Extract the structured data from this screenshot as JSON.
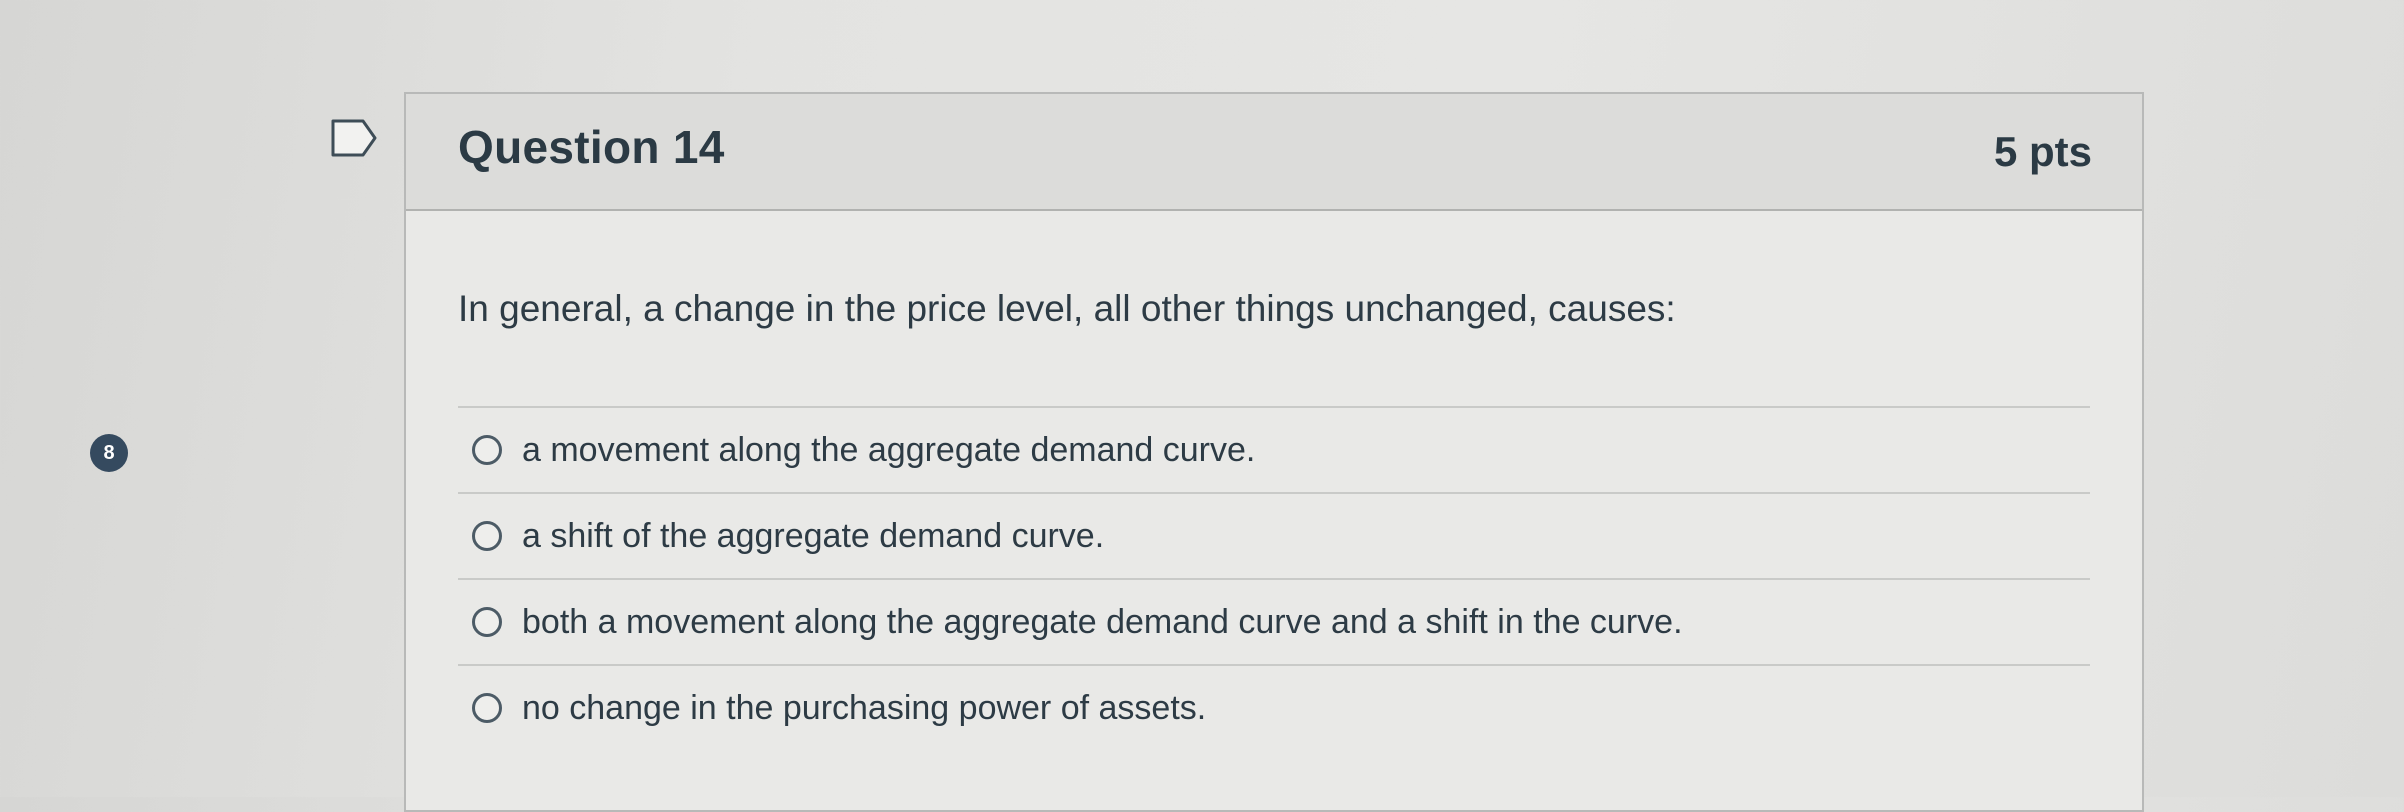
{
  "sidebar": {
    "question_number_badge": "8"
  },
  "question": {
    "title": "Question 14",
    "points": "5 pts",
    "prompt": "In general, a change in the price level, all other things unchanged, causes:",
    "answers": [
      {
        "label": "a movement along the aggregate demand curve."
      },
      {
        "label": "a shift of the aggregate demand curve."
      },
      {
        "label": "both a movement along the aggregate demand curve and a shift in the curve."
      },
      {
        "label": "no change in the purchasing power of assets."
      }
    ]
  },
  "icons": {
    "flag": "flag-outline-icon",
    "radio": "radio-unchecked-icon"
  },
  "colors": {
    "text": "#2d3b45",
    "badge": "#354a5f",
    "header_bg": "#dcdcda",
    "card_bg": "#e9e9e7"
  }
}
